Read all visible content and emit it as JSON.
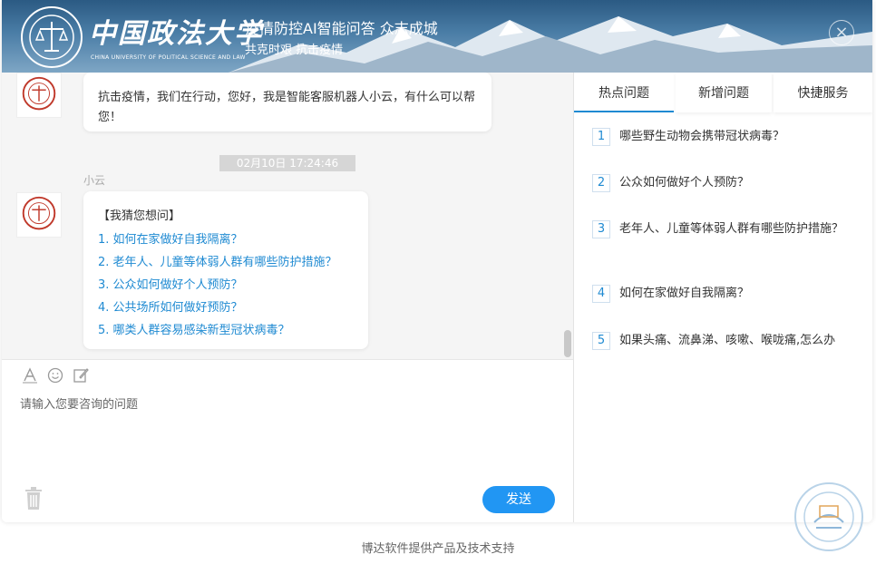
{
  "header": {
    "logo_text": "中国政法大学",
    "logo_sub": "CHINA UNIVERSITY OF POLITICAL SCIENCE AND LAW",
    "title": "疫情防控AI智能问答 众志成城",
    "subtitle": "共克时艰 抗击疫情"
  },
  "chat": {
    "greeting": "抗击疫情，我们在行动，您好，我是智能客服机器人小云，有什么可以帮您！",
    "timestamp": "02月10日 17:24:46",
    "sender": "小云",
    "guess_title": "【我猜您想问】",
    "guess_questions": [
      "1. 如何在家做好自我隔离？",
      "2. 老年人、儿童等体弱人群有哪些防护措施？",
      "3. 公众如何做好个人预防？",
      "4. 公共场所如何做好预防？",
      "5. 哪类人群容易感染新型冠状病毒？"
    ]
  },
  "input": {
    "placeholder": "请输入您要咨询的问题",
    "send_label": "发送"
  },
  "tabs": [
    "热点问题",
    "新增问题",
    "快捷服务"
  ],
  "hot_questions": [
    {
      "num": "1",
      "text": "哪些野生动物会携带冠状病毒？"
    },
    {
      "num": "2",
      "text": "公众如何做好个人预防？"
    },
    {
      "num": "3",
      "text": "老年人、儿童等体弱人群有哪些防护措施？"
    },
    {
      "num": "4",
      "text": "如何在家做好自我隔离？"
    },
    {
      "num": "5",
      "text": "如果头痛、流鼻涕、咳嗽、喉咙痛,怎么办"
    }
  ],
  "footer": "博达软件提供产品及技术支持",
  "colors": {
    "accent": "#1f8ad2",
    "send": "#2196f3",
    "seal": "#c0392b"
  }
}
